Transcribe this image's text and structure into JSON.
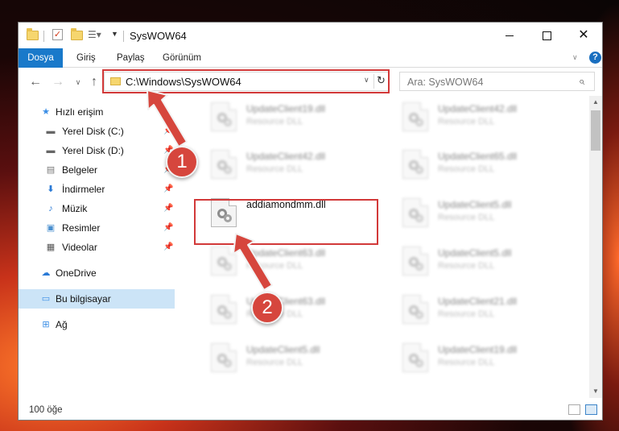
{
  "window": {
    "title": "SysWOW64",
    "buttons": {
      "minimize": "—",
      "maximize": "□",
      "close": "✕"
    }
  },
  "ribbon": {
    "tabs": [
      "Dosya",
      "Giriş",
      "Paylaş",
      "Görünüm"
    ],
    "help": "?"
  },
  "address": {
    "path": "C:\\Windows\\SysWOW64",
    "search_placeholder": "Ara: SysWOW64"
  },
  "sidebar": {
    "items": [
      {
        "label": "Hızlı erişim",
        "icon": "star-icon",
        "pinned": false
      },
      {
        "label": "Yerel Disk (C:)",
        "icon": "drive-icon",
        "pinned": true
      },
      {
        "label": "Yerel Disk (D:)",
        "icon": "drive-icon",
        "pinned": true
      },
      {
        "label": "Belgeler",
        "icon": "documents-icon",
        "pinned": true
      },
      {
        "label": "İndirmeler",
        "icon": "download-icon",
        "pinned": true
      },
      {
        "label": "Müzik",
        "icon": "music-icon",
        "pinned": true
      },
      {
        "label": "Resimler",
        "icon": "pictures-icon",
        "pinned": true
      },
      {
        "label": "Videolar",
        "icon": "video-icon",
        "pinned": true
      },
      {
        "label": "OneDrive",
        "icon": "cloud-icon",
        "pinned": false
      },
      {
        "label": "Bu bilgisayar",
        "icon": "computer-icon",
        "pinned": false,
        "selected": true
      },
      {
        "label": "Ağ",
        "icon": "network-icon",
        "pinned": false
      }
    ]
  },
  "files": [
    {
      "name": "UpdateClient19.dll",
      "type": "Resource DLL",
      "blurred": true
    },
    {
      "name": "UpdateClient42.dll",
      "type": "Resource DLL",
      "blurred": true
    },
    {
      "name": "UpdateClient42.dll",
      "type": "Resource DLL",
      "blurred": true
    },
    {
      "name": "UpdateClient65.dll",
      "type": "Resource DLL",
      "blurred": true
    },
    {
      "name": "addiamondmm.dll",
      "type": "",
      "blurred": false,
      "highlighted": true
    },
    {
      "name": "UpdateClient5.dll",
      "type": "Resource DLL",
      "blurred": true
    },
    {
      "name": "UpdateClient63.dll",
      "type": "Resource DLL",
      "blurred": true
    },
    {
      "name": "UpdateClient5.dll",
      "type": "Resource DLL",
      "blurred": true
    },
    {
      "name": "UpdateClient63.dll",
      "type": "Resource DLL",
      "blurred": true
    },
    {
      "name": "UpdateClient21.dll",
      "type": "Resource DLL",
      "blurred": true
    },
    {
      "name": "UpdateClient5.dll",
      "type": "Resource DLL",
      "blurred": true
    },
    {
      "name": "UpdateClient19.dll",
      "type": "Resource DLL",
      "blurred": true
    }
  ],
  "status": {
    "item_count": "100 öğe"
  },
  "callouts": {
    "step1": "1",
    "step2": "2"
  },
  "colors": {
    "accent": "#1979ca",
    "highlight": "#d23939",
    "selected_bg": "#cce4f7"
  }
}
